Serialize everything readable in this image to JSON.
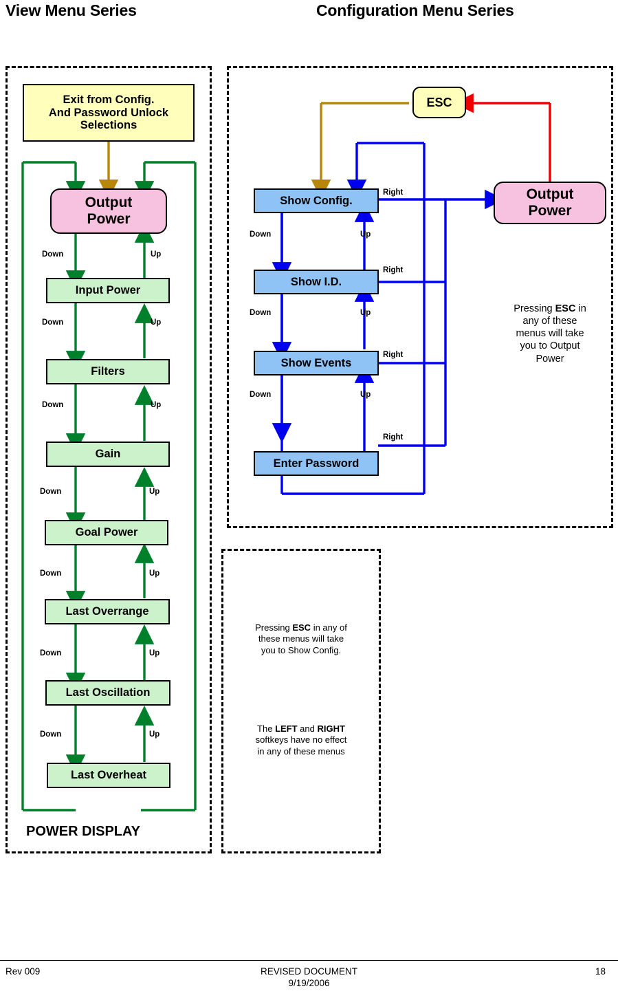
{
  "titles": {
    "left": "View Menu Series",
    "right": "Configuration Menu Series"
  },
  "view_menu": {
    "exit_box": "Exit from Config.\nAnd Password Unlock\nSelections",
    "output_power": "Output\nPower",
    "items": [
      "Input Power",
      "Filters",
      "Gain",
      "Goal Power",
      "Last Overrange",
      "Last Oscillation",
      "Last Overheat"
    ],
    "down_label": "Down",
    "up_label": "Up",
    "power_display": "POWER DISPLAY"
  },
  "config_menu": {
    "esc": "ESC",
    "output_power": "Output\nPower",
    "items": [
      "Show Config.",
      "Show I.D.",
      "Show Events",
      "Enter Password"
    ],
    "right_label": "Right",
    "down_label": "Down",
    "up_label": "Up",
    "note_esc_output": {
      "line1": "Pressing ",
      "bold1": "ESC",
      "line2": " in",
      "rest": "any of these\nmenus will take\nyou to Output\nPower"
    },
    "note_esc_output_text": "Pressing ESC in any of these menus will take you to Output Power"
  },
  "notes_panel": {
    "note1_pre": "Pressing ",
    "note1_bold": "ESC",
    "note1_post": " in any of",
    "note1_rest": "these menus will take\nyou to Show Config.",
    "note2_pre": "The ",
    "note2_bold1": "LEFT",
    "note2_mid": " and ",
    "note2_bold2": "RIGHT",
    "note2_rest": "softkeys have no effect\nin any of these menus"
  },
  "footer": {
    "revision": "Rev 009",
    "center_line1": "REVISED DOCUMENT",
    "center_line2": "9/19/2006",
    "page": "18"
  },
  "colors": {
    "green_arrow": "#00802b",
    "blue_arrow": "#0000ee",
    "red_arrow": "#ee0000",
    "gold_arrow": "#b8860b",
    "box_yellow": "#ffffbb",
    "box_green": "#ccf2cc",
    "box_blue": "#8fc3f5",
    "box_pink": "#f7c2e0"
  }
}
